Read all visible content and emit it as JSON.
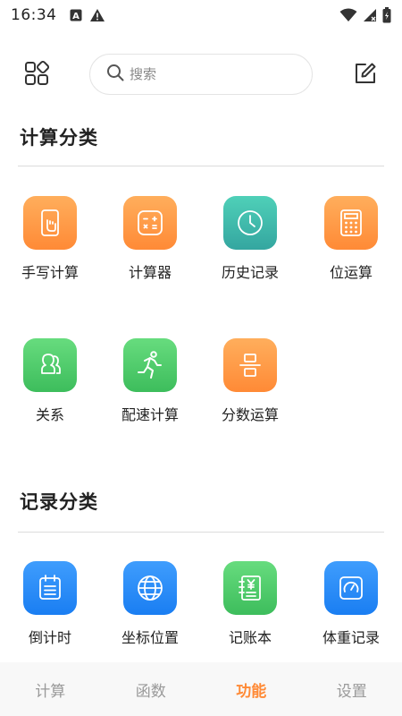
{
  "status_bar": {
    "time": "16:34",
    "left_icons": [
      "a-box-icon",
      "warning-icon"
    ],
    "right_icons": [
      "wifi-icon",
      "signal-icon",
      "battery-icon"
    ]
  },
  "header": {
    "apps_icon": "apps-grid-icon",
    "search": {
      "placeholder": "搜索",
      "value": ""
    },
    "edit_icon": "edit-icon"
  },
  "sections": {
    "calc": {
      "title": "计算分类",
      "items": [
        {
          "label": "手写计算",
          "icon": "handwriting-icon",
          "color": "#ff8a36"
        },
        {
          "label": "计算器",
          "icon": "calculator-icon",
          "color": "#ff8a36"
        },
        {
          "label": "历史记录",
          "icon": "clock-icon",
          "color": "#34a6a0"
        },
        {
          "label": "位运算",
          "icon": "keypad-icon",
          "color": "#ff8a36"
        },
        {
          "label": "关系",
          "icon": "people-icon",
          "color": "#3dbd5c"
        },
        {
          "label": "配速计算",
          "icon": "runner-icon",
          "color": "#3dbd5c"
        },
        {
          "label": "分数运算",
          "icon": "fraction-icon",
          "color": "#ff8a36"
        }
      ]
    },
    "record": {
      "title": "记录分类",
      "items": [
        {
          "label": "倒计时",
          "icon": "calendar-icon",
          "color": "#1a7ef2"
        },
        {
          "label": "坐标位置",
          "icon": "globe-icon",
          "color": "#1a7ef2"
        },
        {
          "label": "记账本",
          "icon": "ledger-icon",
          "color": "#3dbd5c"
        },
        {
          "label": "体重记录",
          "icon": "scale-icon",
          "color": "#1a7ef2"
        }
      ]
    }
  },
  "bottom_nav": {
    "tabs": [
      {
        "label": "计算",
        "active": false
      },
      {
        "label": "函数",
        "active": false
      },
      {
        "label": "功能",
        "active": true
      },
      {
        "label": "设置",
        "active": false
      }
    ],
    "active_color": "#ff8a36"
  }
}
